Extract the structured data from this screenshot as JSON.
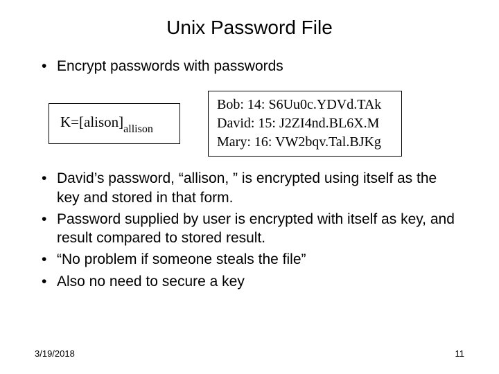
{
  "title": "Unix Password File",
  "top_bullet": "Encrypt passwords with passwords",
  "kbox": {
    "prefix": "K=[alison]",
    "subscript": "allison"
  },
  "pw_entries": [
    "Bob: 14: S6Uu0c.YDVd.TAk",
    "David: 15: J2ZI4nd.BL6X.M",
    "Mary: 16: VW2bqv.Tal.BJKg"
  ],
  "bullets": [
    "David’s password, “allison, ” is encrypted using itself as the key and stored in that form.",
    "Password supplied by user is encrypted with itself as key, and result compared to stored result.",
    "“No problem if someone steals the file”",
    "Also no need to secure a key"
  ],
  "footer": {
    "date": "3/19/2018",
    "page": "11"
  }
}
